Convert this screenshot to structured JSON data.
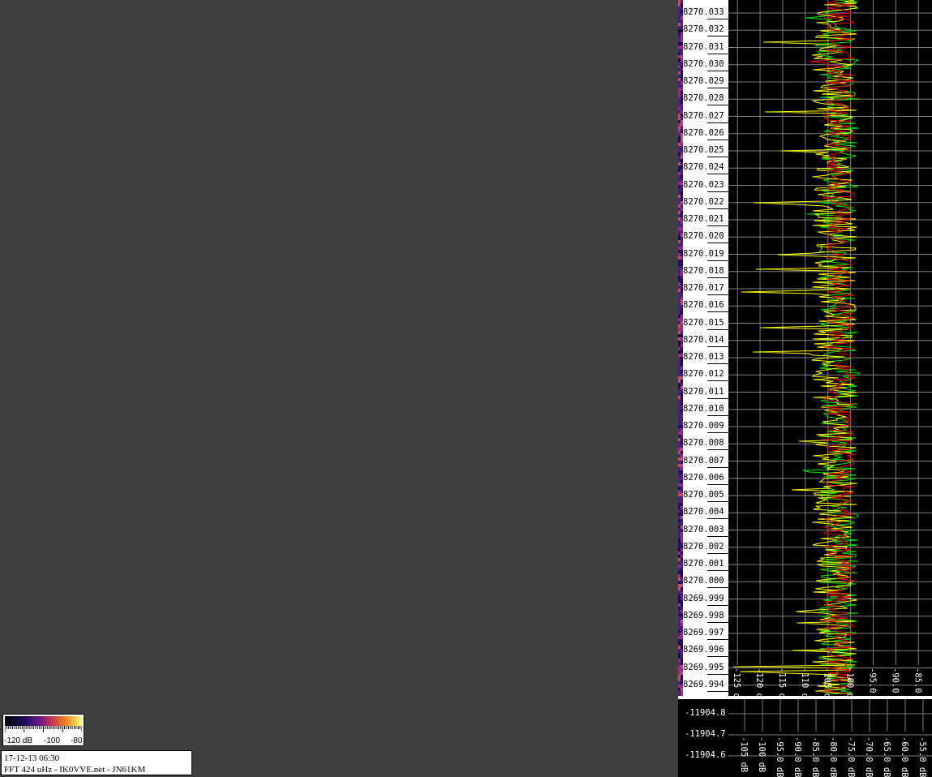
{
  "colorbar": {
    "labels": [
      "-120 dB",
      "-100",
      "-80"
    ]
  },
  "info": {
    "timestamp": "17-12-13 06:30",
    "caption": "FFT 424 uHz - IK0VVE.net - JN61KM"
  },
  "colors": {
    "waterfall_bg": "#404040",
    "trace_yellow": "#ffff00",
    "trace_green": "#00e000",
    "trace_red": "#e00000",
    "grid": "#808080"
  },
  "chart_data": [
    {
      "type": "line",
      "orientation": "vertical",
      "frequency_ticks": [
        "8270.033",
        "8270.032",
        "8270.031",
        "8270.030",
        "8270.029",
        "8270.028",
        "8270.027",
        "8270.026",
        "8270.025",
        "8270.024",
        "8270.023",
        "8270.022",
        "8270.021",
        "8270.020",
        "8270.019",
        "8270.018",
        "8270.017",
        "8270.016",
        "8270.015",
        "8270.014",
        "8270.013",
        "8270.012",
        "8270.011",
        "8270.010",
        "8270.009",
        "8270.008",
        "8270.007",
        "8270.006",
        "8270.005",
        "8270.004",
        "8270.003",
        "8270.002",
        "8270.001",
        "8270.000",
        "8269.999",
        "8269.998",
        "8269.997",
        "8269.996",
        "8269.995",
        "8269.994"
      ],
      "db_ticks": [
        "-125 dB",
        "-120 dB",
        "-115 dB",
        "-110 dB",
        "-105 dB",
        "-100 dB",
        "-95.0 dB",
        "-90.0 dB",
        "-85.0 dB"
      ],
      "xlim": [
        -127,
        -82
      ],
      "series": [
        {
          "color": "#ffff00"
        },
        {
          "color": "#00e000"
        },
        {
          "color": "#e00000"
        }
      ],
      "grid": true
    },
    {
      "type": "line",
      "orientation": "vertical",
      "frequency_ticks": [
        "11904.8",
        "11904.7",
        "11904.6"
      ],
      "db_ticks": [
        "-105 dB",
        "-100 dB",
        "-95.0 dB",
        "-90.0 dB",
        "-85.0 dB",
        "-80.0 dB",
        "-75.0 dB",
        "-70.0 dB",
        "-65.0 dB",
        "-60.0 dB",
        "-55.0 dB"
      ],
      "grid": true
    }
  ]
}
